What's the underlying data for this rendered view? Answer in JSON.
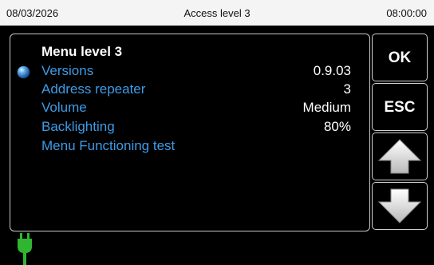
{
  "header": {
    "date": "08/03/2026",
    "access_level": "Access level 3",
    "time": "08:00:00"
  },
  "menu": {
    "title": "Menu level 3",
    "selected_index": 0,
    "items": [
      {
        "label": "Versions",
        "value": "0.9.03"
      },
      {
        "label": "Address repeater",
        "value": "3"
      },
      {
        "label": "Volume",
        "value": "Medium"
      },
      {
        "label": "Backlighting",
        "value": "80%"
      },
      {
        "label": "Menu Functioning test",
        "value": ""
      }
    ]
  },
  "buttons": {
    "ok": "OK",
    "esc": "ESC",
    "up_icon": "arrow-up-icon",
    "down_icon": "arrow-down-icon"
  },
  "status": {
    "power_icon": "power-plug-icon"
  },
  "colors": {
    "menu_item_text": "#3e9be6",
    "header_background": "#f4f4f4",
    "power_indicator": "#2fb52f",
    "background": "#000000"
  }
}
